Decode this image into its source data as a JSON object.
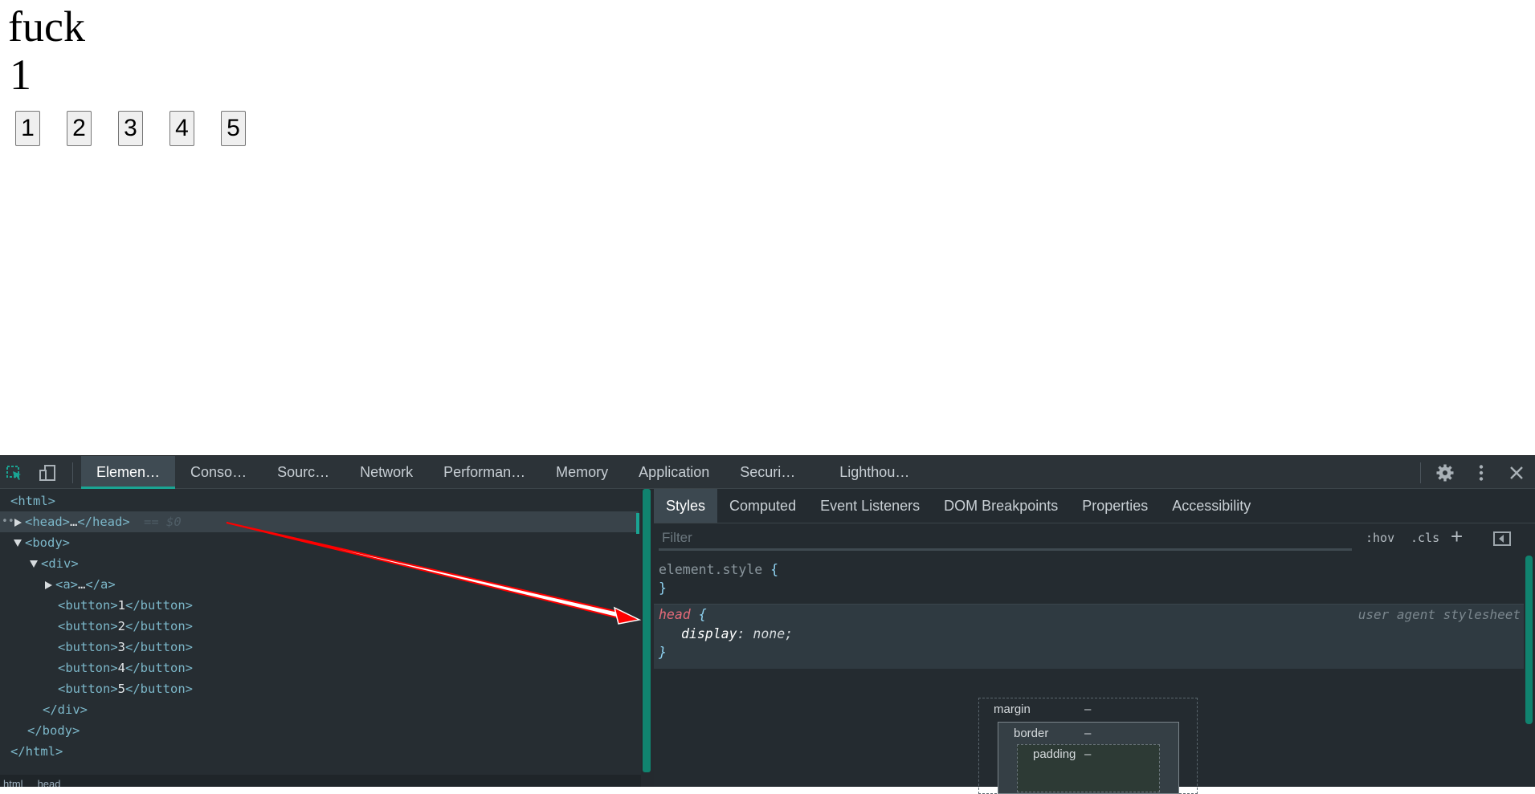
{
  "page": {
    "heading": "fuck",
    "number": "1",
    "buttons": [
      "1",
      "2",
      "3",
      "4",
      "5"
    ]
  },
  "devtools": {
    "tabs": [
      "Elemen…",
      "Conso…",
      "Sourc…",
      "Network",
      "Performan…",
      "Memory",
      "Application",
      "Securi…",
      "Lighthou…"
    ],
    "active_tab": "Elemen…",
    "accent_color": "#1aa493",
    "tree": {
      "html_open": "<html>",
      "head_open": "<head>",
      "head_ellipsis": "…",
      "head_close": "</head>",
      "selected_marker": "== $0",
      "body_open": "<body>",
      "div_open": "<div>",
      "a_open": "<a>",
      "a_ellipsis": "…",
      "a_close": "</a>",
      "button_rows": [
        {
          "open": "<button>",
          "text": "1",
          "close": "</button>"
        },
        {
          "open": "<button>",
          "text": "2",
          "close": "</button>"
        },
        {
          "open": "<button>",
          "text": "3",
          "close": "</button>"
        },
        {
          "open": "<button>",
          "text": "4",
          "close": "</button>"
        },
        {
          "open": "<button>",
          "text": "5",
          "close": "</button>"
        }
      ],
      "div_close": "</div>",
      "body_close": "</body>",
      "html_close": "</html>"
    },
    "breadcrumbs": [
      "html",
      "head"
    ],
    "styles": {
      "subtabs": [
        "Styles",
        "Computed",
        "Event Listeners",
        "DOM Breakpoints",
        "Properties",
        "Accessibility"
      ],
      "active_subtab": "Styles",
      "filter_placeholder": "Filter",
      "hov_label": ":hov",
      "cls_label": ".cls",
      "plus_label": "+",
      "element_style_selector": "element.style",
      "open_brace": "{",
      "close_brace": "}",
      "head_selector": "head",
      "head_prop_name": "display",
      "head_prop_value": "none;",
      "head_source": "user agent stylesheet",
      "box_model": {
        "margin_label": "margin",
        "margin_value": "–",
        "border_label": "border",
        "border_value": "–",
        "padding_label": "padding",
        "padding_value": "–"
      }
    }
  },
  "annotation": {
    "arrow_color": "#ff0000"
  }
}
